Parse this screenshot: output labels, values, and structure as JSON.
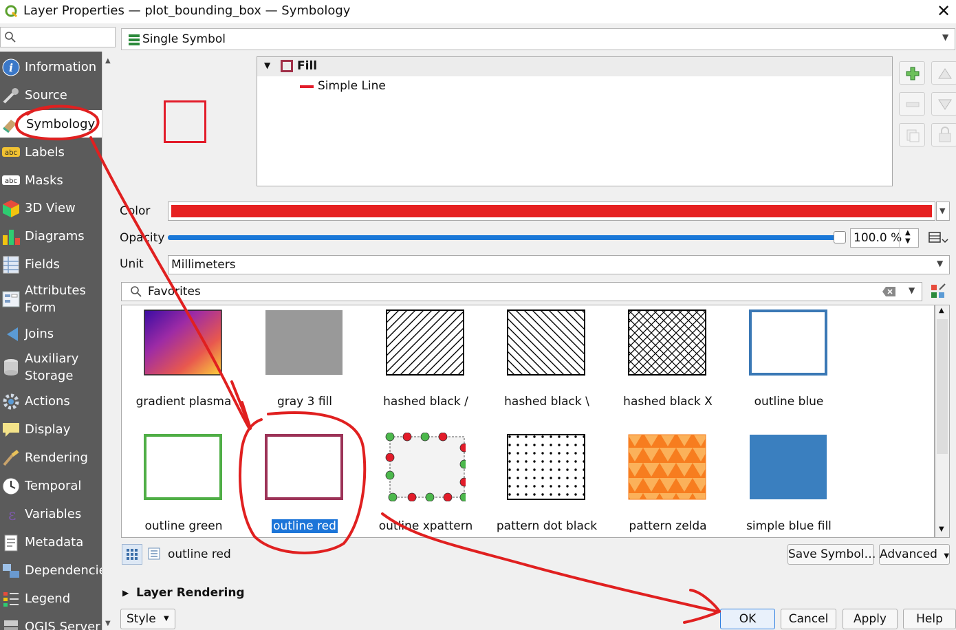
{
  "window": {
    "title": "Layer Properties — plot_bounding_box — Symbology"
  },
  "sidebar": {
    "search_placeholder": "",
    "items": [
      {
        "label": "Information",
        "icon": "info-icon"
      },
      {
        "label": "Source",
        "icon": "source-wrench-icon"
      },
      {
        "label": "Symbology",
        "icon": "symbology-paint-icon"
      },
      {
        "label": "Labels",
        "icon": "labels-abc-icon"
      },
      {
        "label": "Masks",
        "icon": "masks-abc-icon"
      },
      {
        "label": "3D View",
        "icon": "3d-cube-icon"
      },
      {
        "label": "Diagrams",
        "icon": "diagrams-icon"
      },
      {
        "label": "Fields",
        "icon": "fields-icon"
      },
      {
        "label": "Attributes Form",
        "icon": "attributes-form-icon"
      },
      {
        "label": "Joins",
        "icon": "joins-icon"
      },
      {
        "label": "Auxiliary Storage",
        "icon": "auxiliary-storage-icon"
      },
      {
        "label": "Actions",
        "icon": "actions-gear-icon"
      },
      {
        "label": "Display",
        "icon": "display-speech-icon"
      },
      {
        "label": "Rendering",
        "icon": "rendering-brush-icon"
      },
      {
        "label": "Temporal",
        "icon": "temporal-clock-icon"
      },
      {
        "label": "Variables",
        "icon": "variables-epsilon-icon"
      },
      {
        "label": "Metadata",
        "icon": "metadata-icon"
      },
      {
        "label": "Dependencies",
        "icon": "dependencies-icon"
      },
      {
        "label": "Legend",
        "icon": "legend-icon"
      },
      {
        "label": "QGIS Server",
        "icon": "qgis-server-icon"
      }
    ],
    "active": "Symbology"
  },
  "renderer": {
    "selected": "Single Symbol"
  },
  "symbol_tree": {
    "root": "Fill",
    "child": "Simple Line"
  },
  "properties": {
    "color_label": "Color",
    "color_value": "#e62020",
    "opacity_label": "Opacity",
    "opacity_value": "100.0 %",
    "opacity_fraction": 1.0,
    "unit_label": "Unit",
    "unit_value": "Millimeters"
  },
  "library": {
    "filter": "Favorites",
    "symbols": [
      {
        "name": "gradient plasma"
      },
      {
        "name": "gray 3 fill"
      },
      {
        "name": "hashed black /"
      },
      {
        "name": "hashed black \\"
      },
      {
        "name": "hashed black X"
      },
      {
        "name": "outline blue"
      },
      {
        "name": "outline green"
      },
      {
        "name": "outline red",
        "selected": true
      },
      {
        "name": "outline xpattern"
      },
      {
        "name": "pattern dot black"
      },
      {
        "name": "pattern zelda"
      },
      {
        "name": "simple blue fill"
      }
    ],
    "current_symbol": "outline red",
    "save_symbol_label": "Save Symbol…",
    "advanced_label": "Advanced"
  },
  "layer_rendering": {
    "label": "Layer Rendering"
  },
  "footer": {
    "style_label": "Style",
    "ok_label": "OK",
    "cancel_label": "Cancel",
    "apply_label": "Apply",
    "help_label": "Help"
  },
  "colors": {
    "sidebar_bg": "#5b5b5b",
    "accent_blue": "#1c75d8",
    "annotation_red": "#e02020"
  }
}
